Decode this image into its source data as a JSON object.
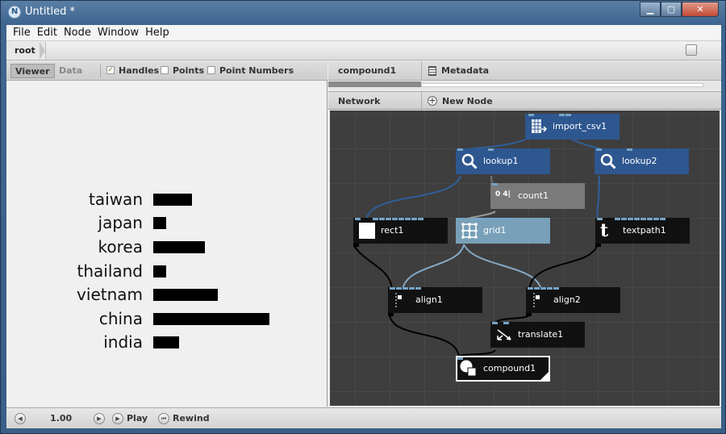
{
  "window": {
    "title": "Untitled *",
    "controls": {
      "minimize": "▁",
      "maximize": "▢",
      "close": "✕"
    }
  },
  "menu": [
    "File",
    "Edit",
    "Node",
    "Window",
    "Help"
  ],
  "path": {
    "crumb": "root"
  },
  "viewer": {
    "tabs": {
      "viewer": "Viewer",
      "data": "Data"
    },
    "options": [
      {
        "label": "Handles",
        "checked": true
      },
      {
        "label": "Points",
        "checked": false
      },
      {
        "label": "Point Numbers",
        "checked": false
      }
    ],
    "bars": [
      {
        "label": "taiwan",
        "value": 48
      },
      {
        "label": "japan",
        "value": 16
      },
      {
        "label": "korea",
        "value": 64
      },
      {
        "label": "thailand",
        "value": 16
      },
      {
        "label": "vietnam",
        "value": 80
      },
      {
        "label": "china",
        "value": 144
      },
      {
        "label": "india",
        "value": 32
      }
    ]
  },
  "parameters": {
    "title": "compound1",
    "metadata": "Metadata"
  },
  "network": {
    "title": "Network",
    "new_node": "New Node",
    "nodes": {
      "import_csv1": "import_csv1",
      "lookup1": "lookup1",
      "lookup2": "lookup2",
      "count1": "count1",
      "count1_icon": "0 4|",
      "rect1": "rect1",
      "grid1": "grid1",
      "textpath1": "textpath1",
      "textpath1_icon": "t",
      "align1": "align1",
      "align2": "align2",
      "translate1": "translate1",
      "compound1": "compound1"
    }
  },
  "playback": {
    "frame": "1.00",
    "play": "Play",
    "rewind": "Rewind"
  },
  "colors": {
    "node_blue": "#2e5790",
    "node_black": "#111111",
    "node_gray": "#7a7a7a",
    "node_selected_light": "#78a0b8",
    "wire_blue": "#2f5f9a",
    "wire_light": "#86a9c4",
    "wire_black": "#000000",
    "canvas": "#3e3e3e"
  }
}
